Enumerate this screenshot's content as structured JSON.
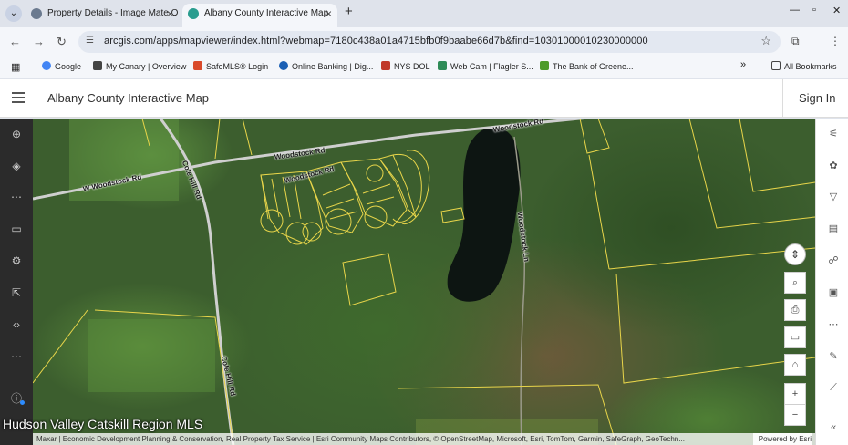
{
  "browser": {
    "tabs": [
      {
        "title": "Property Details - Image Mate O",
        "favicon": "globe-icon"
      },
      {
        "title": "Albany County Interactive Map",
        "favicon": "arcgis-icon"
      }
    ],
    "url": "arcgis.com/apps/mapviewer/index.html?webmap=7180c438a01a4715bfb0f9baabe66d7b&find=10301000010230000000",
    "bookmarks": [
      {
        "label": "Google",
        "color": "#4285f4"
      },
      {
        "label": "My Canary | Overview",
        "color": "#444444"
      },
      {
        "label": "SafeMLS® Login",
        "color": "#d94a2b"
      },
      {
        "label": "Online Banking | Dig...",
        "color": "#1a5fb4"
      },
      {
        "label": "NYS DOL",
        "color": "#c0392b"
      },
      {
        "label": "Web Cam | Flagler S...",
        "color": "#2e8b57"
      },
      {
        "label": "The Bank of Greene...",
        "color": "#4c9a2a"
      }
    ],
    "all_bookmarks": "All Bookmarks",
    "more_bookmarks": "»"
  },
  "app": {
    "title": "Albany County Interactive Map",
    "sign_in": "Sign In"
  },
  "map": {
    "road_labels": [
      "Woodstock Rd",
      "Woodstock Rd",
      "Woodstock Rd",
      "W Woodstock Rd",
      "Cole Hill Rd",
      "Cole Hill Rd",
      "Woodstock Ln"
    ],
    "zoom_in": "+",
    "zoom_out": "−",
    "watermark": "Hudson Valley Catskill Region MLS",
    "attribution": "Maxar | Economic Development Planning & Conservation, Real Property Tax Service | Esri Community Maps Contributors, © OpenStreetMap, Microsoft, Esri, TomTom, Garmin, SafeGraph, GeoTechn...",
    "powered_by": "Powered by Esri"
  },
  "colors": {
    "parcel_line": "#e8d54a",
    "road": "#cfcfcf",
    "lake": "#0d1512",
    "left_rail": "#2b2b2b"
  }
}
